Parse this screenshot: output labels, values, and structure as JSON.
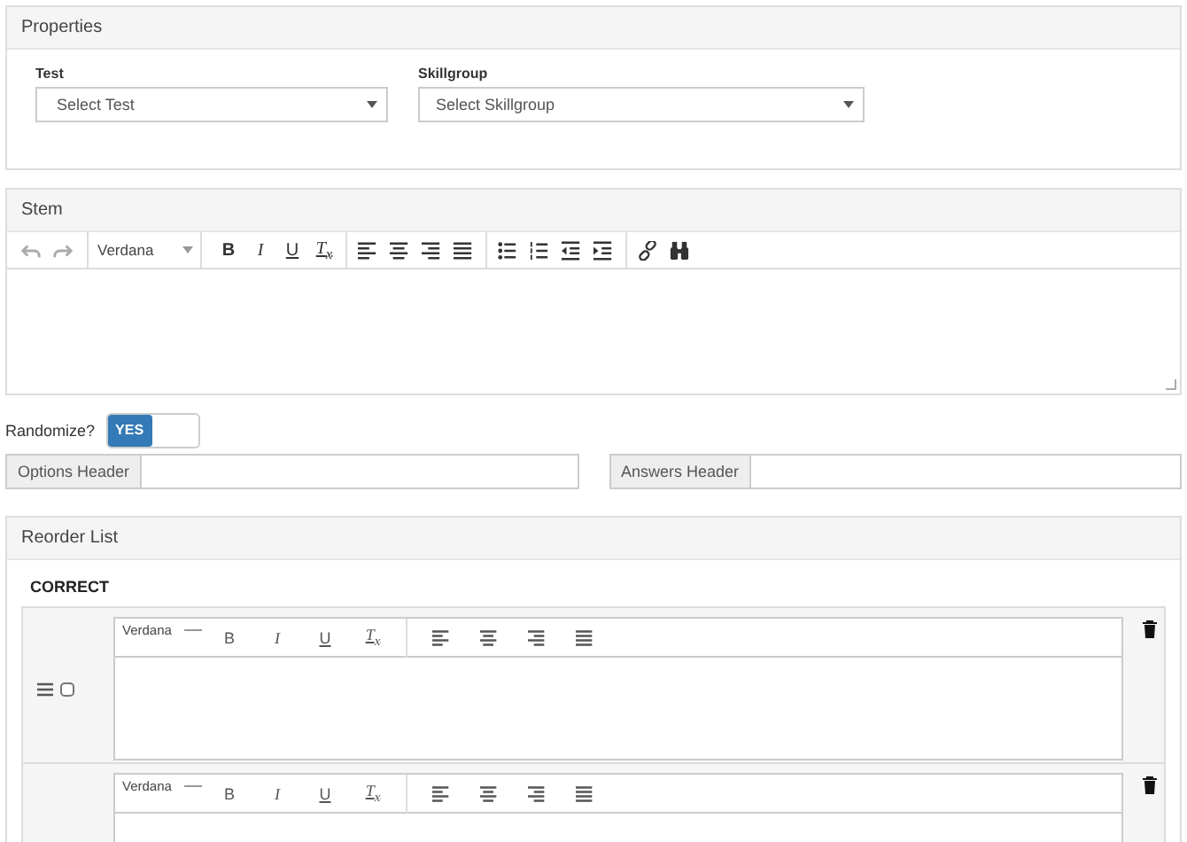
{
  "properties": {
    "title": "Properties",
    "fields": [
      {
        "label": "Test",
        "placeholder": "Select Test"
      },
      {
        "label": "Skillgroup",
        "placeholder": "Select Skillgroup"
      }
    ]
  },
  "stem": {
    "title": "Stem",
    "font": "Verdana",
    "groups": [
      {
        "tools": [
          {
            "kind": "undo",
            "disabled": true
          },
          {
            "kind": "redo",
            "disabled": true
          }
        ]
      },
      {
        "tools": [
          {
            "kind": "bold",
            "label": "B",
            "disabled": false
          },
          {
            "kind": "italic",
            "label": "I",
            "disabled": false
          },
          {
            "kind": "underline",
            "label": "U",
            "disabled": false
          },
          {
            "kind": "clear",
            "label": "T$_{x}$",
            "disabled": false
          }
        ]
      },
      {
        "tools": [
          {
            "kind": "align-left",
            "disabled": false
          },
          {
            "kind": "align-center",
            "disabled": false
          },
          {
            "kind": "align-right",
            "disabled": false
          },
          {
            "kind": "justify",
            "disabled": false
          }
        ]
      },
      {
        "tools": [
          {
            "kind": "bullets",
            "disabled": false
          },
          {
            "kind": "numbers",
            "disabled": false
          },
          {
            "kind": "outdent",
            "disabled": false
          },
          {
            "kind": "indent",
            "disabled": false
          }
        ]
      },
      {
        "tools": [
          {
            "kind": "link",
            "disabled": false
          },
          {
            "kind": "binoculars",
            "disabled": false
          }
        ]
      }
    ]
  },
  "randomize": {
    "label": "Randomize?",
    "toggle_label": "YES",
    "on": true
  },
  "headers": [
    {
      "label": "Options Header"
    },
    {
      "label": "Answers Header"
    }
  ],
  "reorder_list": {
    "title": "Reorder List",
    "group_label": "CORRECT",
    "items": [
      {
        "checked": false,
        "font": "Verdana",
        "tools": [
          {
            "kind": "bold",
            "label": "B"
          },
          {
            "kind": "italic",
            "label": "I"
          },
          {
            "kind": "underline",
            "label": "U"
          },
          {
            "kind": "clear",
            "label": "T$_{x}$"
          },
          {
            "kind": "align-left"
          },
          {
            "kind": "align-center"
          },
          {
            "kind": "align-right"
          },
          {
            "kind": "justify"
          }
        ]
      },
      {
        "font": "Verdana",
        "tools": [
          {
            "kind": "bold",
            "label": "B"
          },
          {
            "kind": "italic",
            "label": "I"
          },
          {
            "kind": "underline",
            "label": "U"
          },
          {
            "kind": "clear",
            "label": "T$_{x}$"
          },
          {
            "kind": "align-left"
          },
          {
            "kind": "align-center"
          },
          {
            "kind": "align-right"
          },
          {
            "kind": "justify"
          }
        ]
      }
    ]
  }
}
